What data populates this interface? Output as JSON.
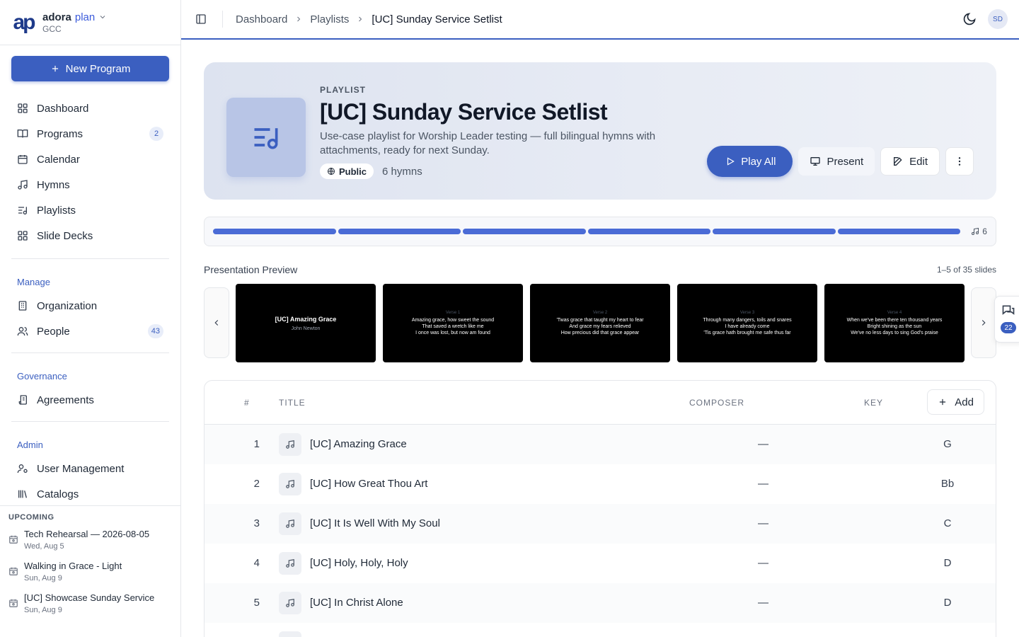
{
  "brand": {
    "logo": "ap",
    "name": "adora",
    "name_accent": "plan",
    "org": "GCC"
  },
  "sidebar": {
    "new_program": "New Program",
    "main_items": [
      {
        "label": "Dashboard",
        "icon": "dashboard-icon"
      },
      {
        "label": "Programs",
        "icon": "book-icon",
        "count": "2"
      },
      {
        "label": "Calendar",
        "icon": "calendar-icon"
      },
      {
        "label": "Hymns",
        "icon": "music-note-icon"
      },
      {
        "label": "Playlists",
        "icon": "playlist-icon"
      },
      {
        "label": "Slide Decks",
        "icon": "slides-icon"
      }
    ],
    "manage_title": "Manage",
    "manage_items": [
      {
        "label": "Organization",
        "icon": "building-icon"
      },
      {
        "label": "People",
        "icon": "people-icon",
        "count": "43"
      }
    ],
    "governance_title": "Governance",
    "governance_items": [
      {
        "label": "Agreements",
        "icon": "scroll-icon"
      }
    ],
    "admin_title": "Admin",
    "admin_items": [
      {
        "label": "User Management",
        "icon": "user-cog-icon"
      },
      {
        "label": "Catalogs",
        "icon": "library-icon"
      }
    ],
    "upcoming_title": "UPCOMING",
    "upcoming": [
      {
        "title": "Tech Rehearsal — 2026-08-05",
        "date": "Wed, Aug 5"
      },
      {
        "title": "Walking in Grace - Light",
        "date": "Sun, Aug 9"
      },
      {
        "title": "[UC] Showcase Sunday Service",
        "date": "Sun, Aug 9"
      }
    ]
  },
  "topbar": {
    "breadcrumbs": [
      "Dashboard",
      "Playlists",
      "[UC] Sunday Service Setlist"
    ],
    "avatar": "SD"
  },
  "hero": {
    "eyebrow": "PLAYLIST",
    "title": "[UC] Sunday Service Setlist",
    "description": "Use-case playlist for Worship Leader testing — full bilingual hymns with attachments, ready for next Sunday.",
    "visibility": "Public",
    "hymn_count": "6 hymns",
    "play_all": "Play All",
    "present": "Present",
    "edit": "Edit"
  },
  "progress": {
    "segments": 6,
    "count": "6"
  },
  "preview": {
    "title": "Presentation Preview",
    "range": "1–5 of 35 slides",
    "slides": [
      {
        "title": "[UC] Amazing Grace",
        "subtitle": "John Newton"
      },
      {
        "label": "Verse 1",
        "lines": [
          "Amazing grace, how sweet the sound",
          "That saved a wretch like me",
          "I once was lost, but now am found"
        ]
      },
      {
        "label": "Verse 2",
        "lines": [
          "'Twas grace that taught my heart to fear",
          "And grace my fears relieved",
          "How precious did that grace appear"
        ]
      },
      {
        "label": "Verse 3",
        "lines": [
          "Through many dangers, toils and snares",
          "I have already come",
          "'Tis grace hath brought me safe thus far"
        ]
      },
      {
        "label": "Verse 4",
        "lines": [
          "When we've been there ten thousand years",
          "Bright shining as the sun",
          "We've no less days to sing God's praise"
        ]
      }
    ]
  },
  "chat": {
    "badge": "22"
  },
  "table": {
    "headers": {
      "num": "#",
      "title": "TITLE",
      "composer": "COMPOSER",
      "key": "KEY"
    },
    "add_label": "Add",
    "rows": [
      {
        "num": "1",
        "title": "[UC] Amazing Grace",
        "composer": "—",
        "key": "G"
      },
      {
        "num": "2",
        "title": "[UC] How Great Thou Art",
        "composer": "—",
        "key": "Bb"
      },
      {
        "num": "3",
        "title": "[UC] It Is Well With My Soul",
        "composer": "—",
        "key": "C"
      },
      {
        "num": "4",
        "title": "[UC] Holy, Holy, Holy",
        "composer": "—",
        "key": "D"
      },
      {
        "num": "5",
        "title": "[UC] In Christ Alone",
        "composer": "—",
        "key": "D"
      }
    ]
  },
  "colors": {
    "accent": "#3b5fc0",
    "sidebar_section": "#3b5fc0",
    "hero_bg": "#e3e8f2"
  }
}
